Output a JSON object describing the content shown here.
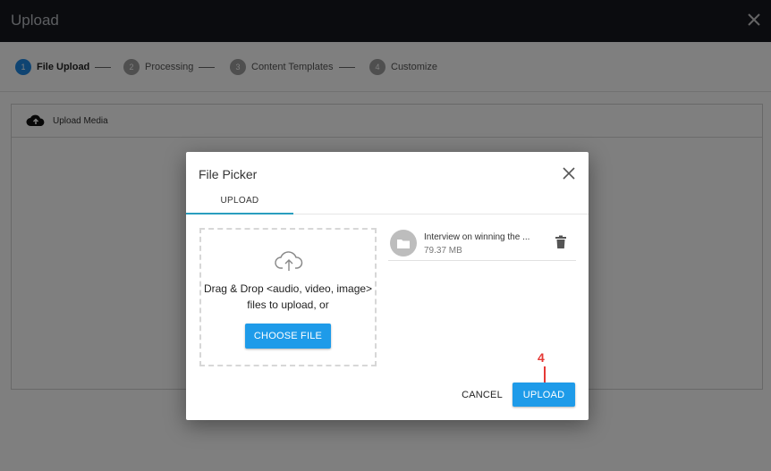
{
  "header": {
    "title": "Upload"
  },
  "stepper": {
    "steps": [
      {
        "num": "1",
        "label": "File Upload"
      },
      {
        "num": "2",
        "label": "Processing"
      },
      {
        "num": "3",
        "label": "Content Templates"
      },
      {
        "num": "4",
        "label": "Customize"
      }
    ]
  },
  "panel": {
    "title": "Upload Media"
  },
  "dialog": {
    "title": "File Picker",
    "tab_label": "UPLOAD",
    "dropzone": {
      "line1": "Drag & Drop <audio, video, image>",
      "line2": "files to upload, or"
    },
    "choose_label": "CHOOSE FILE",
    "file": {
      "name": "Interview on winning the ...",
      "size": "79.37 MB"
    },
    "cancel_label": "CANCEL",
    "upload_label": "UPLOAD"
  },
  "annotation": {
    "label": "4"
  },
  "colors": {
    "accent": "#1e9be9",
    "header_bg": "#17191f",
    "annotation": "#e53935",
    "tab_underline": "#2a9ebf"
  }
}
